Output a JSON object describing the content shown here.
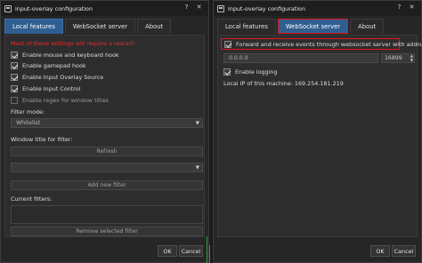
{
  "window_title": "input-overlay configuration",
  "help_glyph": "?",
  "close_glyph": "✕",
  "tabs": [
    "Local features",
    "WebSocket server",
    "About"
  ],
  "local": {
    "warning": "Most of these settings will require a restart!",
    "checkboxes": [
      {
        "label": "Enable mouse and keyboard hook",
        "checked": true
      },
      {
        "label": "Enable gamepad hook",
        "checked": true
      },
      {
        "label": "Enable Input Overlay Source",
        "checked": true
      },
      {
        "label": "Enable Input Control",
        "checked": true
      },
      {
        "label": "Enable regex for window titles",
        "checked": false
      }
    ],
    "filter_mode_label": "Filter mode:",
    "filter_mode_value": "Whitelist",
    "window_title_label": "Window title for filter:",
    "refresh_label": "Refresh",
    "add_filter_label": "Add new filter",
    "current_filters_label": "Current filters:",
    "remove_filter_label": "Remove selected filter"
  },
  "ws": {
    "forward_label": "Forward and receive events through websocket server with address",
    "forward_checked": true,
    "address_value": "0.0.0.0",
    "port_value": "16899",
    "logging_label": "Enable logging",
    "logging_checked": true,
    "local_ip_text": "Local IP of this machine: 169.254.181.219"
  },
  "footer": {
    "ok": "OK",
    "cancel": "Cancel"
  },
  "colors": {
    "accent_tab": "#2f5e91",
    "highlight": "#e0161f",
    "warning": "#e03131"
  }
}
